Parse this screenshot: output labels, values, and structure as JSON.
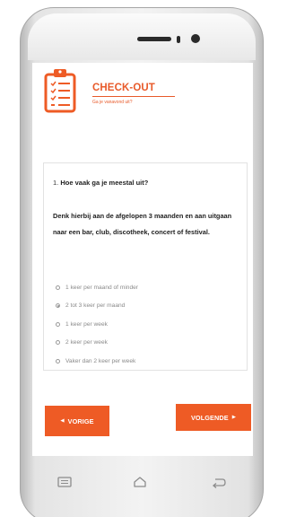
{
  "header": {
    "title": "CHECK-OUT",
    "subtitle": "Ga je vanavond uit?",
    "icon": "clipboard-checklist-icon",
    "accent_color": "#ee5b25"
  },
  "question": {
    "number": "1.",
    "text": "Hoe vaak ga je meestal uit?",
    "description": "Denk hierbij aan de afgelopen 3 maanden en aan uitgaan naar een bar, club, discotheek, concert of festival.",
    "options": [
      {
        "label": "1 keer per maand of minder",
        "selected": false
      },
      {
        "label": "2 tot 3 keer per maand",
        "selected": true
      },
      {
        "label": "1 keer per week",
        "selected": false
      },
      {
        "label": "2 keer per week",
        "selected": false
      },
      {
        "label": "Vaker dan 2 keer per week",
        "selected": false
      }
    ]
  },
  "buttons": {
    "prev_label": "VORIGE",
    "next_label": "VOLGENDE",
    "prev_icon": "left-triangle-icon",
    "next_icon": "right-triangle-icon"
  },
  "navbar": {
    "menu_icon": "recent-apps-icon",
    "home_icon": "home-icon",
    "back_icon": "back-icon"
  }
}
